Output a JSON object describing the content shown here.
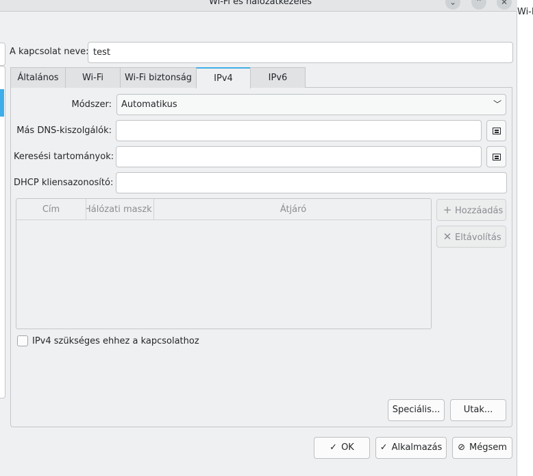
{
  "window": {
    "title": "Wi-Fi és hálózatkezelés"
  },
  "outside_text": "Wi-F",
  "titlebar_buttons": {
    "minimize_icon": "⌄",
    "maximize_icon": "⌃",
    "close_icon": "✕"
  },
  "connection_name": {
    "label": "A kapcsolat neve:",
    "value": "test"
  },
  "tabs": [
    {
      "label": "Általános"
    },
    {
      "label": "Wi-Fi"
    },
    {
      "label": "Wi-Fi biztonság"
    },
    {
      "label": "IPv4"
    },
    {
      "label": "IPv6"
    }
  ],
  "active_tab": "IPv4",
  "ipv4": {
    "method_label": "Módszer:",
    "method_value": "Automatikus",
    "dns_label": "Más DNS-kiszolgálók:",
    "dns_value": "",
    "search_label": "Keresési tartományok:",
    "search_value": "",
    "dhcp_label": "DHCP kliensazonosító:",
    "dhcp_value": "",
    "table_headers": [
      "Cím",
      "Hálózati maszk",
      "Átjáró"
    ],
    "add_button": "Hozzáadás",
    "remove_button": "Eltávolítás",
    "required_checkbox_label": "IPv4 szükséges ehhez a kapcsolathoz",
    "required_checked": false,
    "special_button": "Speciális...",
    "routes_button": "Utak..."
  },
  "footer": {
    "ok": "OK",
    "apply": "Alkalmazás",
    "cancel": "Mégsem"
  },
  "colors": {
    "accent": "#3daee9",
    "window_bg": "#eff0f1",
    "text": "#232629",
    "disabled_text": "#8a8e92"
  }
}
